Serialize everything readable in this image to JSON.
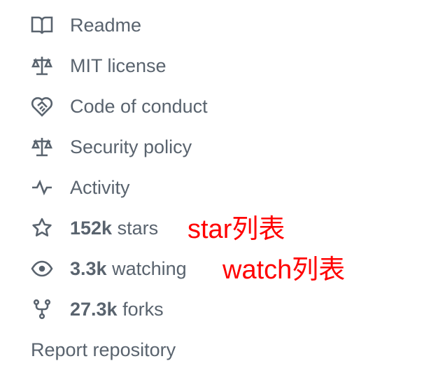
{
  "sidebar": {
    "readme": "Readme",
    "license": "MIT license",
    "conduct": "Code of conduct",
    "security": "Security policy",
    "activity": "Activity",
    "stars_count": "152k",
    "stars_label": " stars",
    "watching_count": "3.3k",
    "watching_label": " watching",
    "forks_count": "27.3k",
    "forks_label": " forks",
    "report": "Report repository"
  },
  "annotations": {
    "stars_note": "star列表",
    "watch_note": "watch列表"
  },
  "colors": {
    "text": "#59636e",
    "annotation": "#ff0000"
  }
}
